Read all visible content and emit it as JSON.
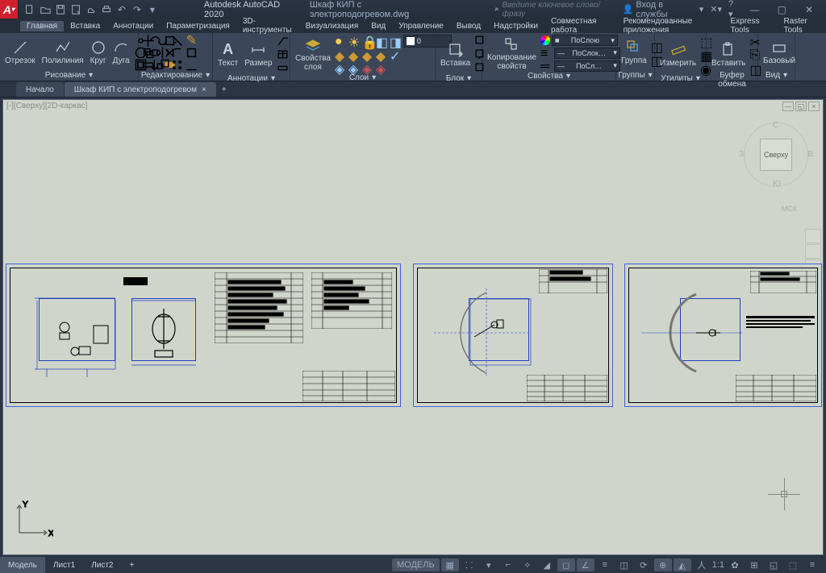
{
  "title": {
    "app": "Autodesk AutoCAD 2020",
    "file": "Шкаф КИП с электроподогревом.dwg"
  },
  "search": {
    "placeholder": "Введите ключевое слово/фразу"
  },
  "signin": "Вход в службы",
  "menus": [
    "Главная",
    "Вставка",
    "Аннотации",
    "Параметризация",
    "3D-инструменты",
    "Визуализация",
    "Вид",
    "Управление",
    "Вывод",
    "Надстройки",
    "Совместная работа",
    "Рекомендованные приложения",
    "Express Tools",
    "Raster Tools"
  ],
  "ribbon": {
    "draw": {
      "title": "Рисование",
      "items": [
        "Отрезок",
        "Полилиния",
        "Круг",
        "Дуга"
      ]
    },
    "edit": {
      "title": "Редактирование"
    },
    "annot": {
      "title": "Аннотации",
      "items": [
        "Текст",
        "Размер"
      ]
    },
    "layers": {
      "title": "Слои",
      "item": "Свойства слоя",
      "cur": "0"
    },
    "block": {
      "title": "Блок",
      "item": "Вставка"
    },
    "props": {
      "title": "Свойства",
      "item": "Копирование свойств",
      "by": "ПоСлою",
      "by2": "ПоСлок…",
      "by3": "ПоСл…"
    },
    "groups": {
      "title": "Группы",
      "item": "Группа"
    },
    "utils": {
      "title": "Утилиты",
      "item": "Измерить"
    },
    "clip": {
      "title": "Буфер обмена",
      "item": "Вставить"
    },
    "view": {
      "title": "Вид",
      "item": "Базовый"
    }
  },
  "tabs": {
    "start": "Начало",
    "file": "Шкаф КИП с электроподогревом"
  },
  "viewport": {
    "label": "[-][Сверху][2D-каркас]",
    "cube": "Сверху",
    "n": "С",
    "s": "Ю",
    "e": "В",
    "w": "З",
    "wcs": "МСК"
  },
  "bottom": {
    "tabs": [
      "Модель",
      "Лист1",
      "Лист2"
    ],
    "model": "МОДЕЛЬ",
    "scale": "1:1"
  }
}
